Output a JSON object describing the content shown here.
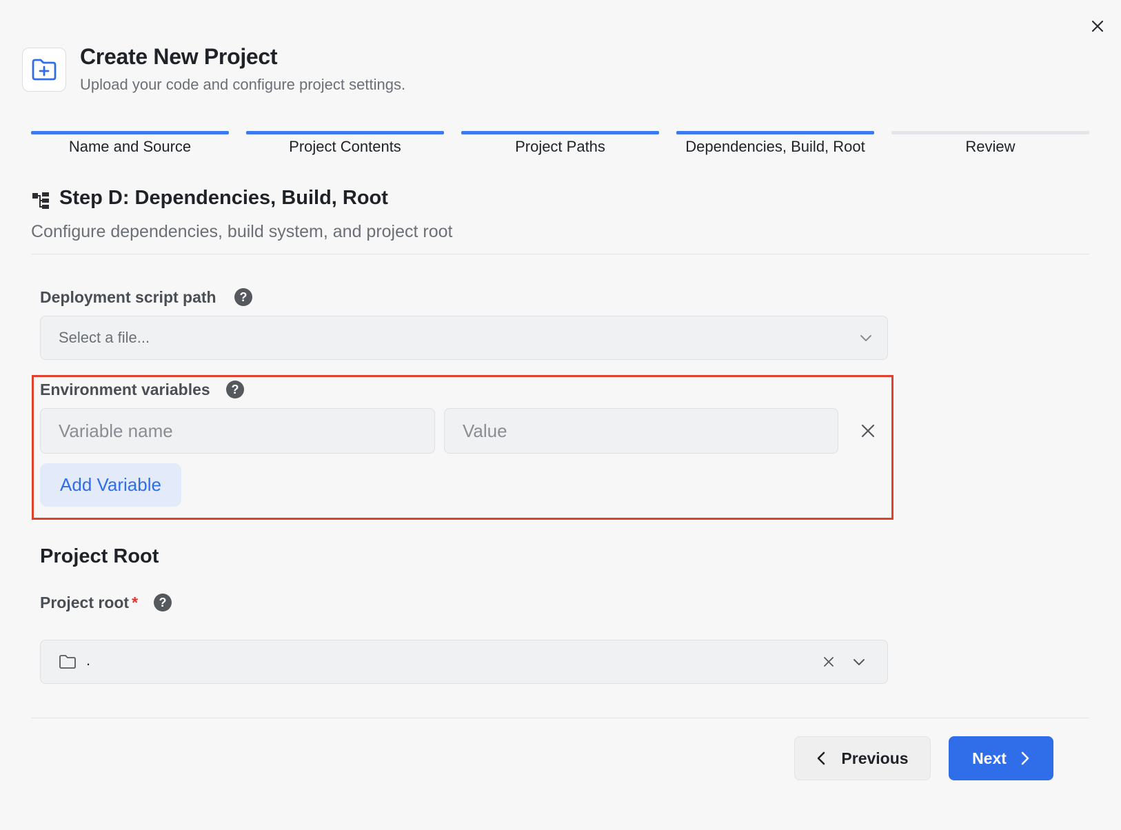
{
  "header": {
    "title": "Create New Project",
    "subtitle": "Upload your code and configure project settings.",
    "icon": "folder-plus-icon"
  },
  "steps": [
    {
      "label": "Name and Source",
      "complete": true
    },
    {
      "label": "Project Contents",
      "complete": true
    },
    {
      "label": "Project Paths",
      "complete": true
    },
    {
      "label": "Dependencies, Build, Root",
      "complete": true
    },
    {
      "label": "Review",
      "complete": false
    }
  ],
  "section": {
    "title": "Step D: Dependencies, Build, Root",
    "subtitle": "Configure dependencies, build system, and project root",
    "icon": "hierarchy-icon"
  },
  "deployment_script": {
    "label": "Deployment script path",
    "placeholder": "Select a file..."
  },
  "env_vars": {
    "label": "Environment variables",
    "name_placeholder": "Variable name",
    "value_placeholder": "Value",
    "add_label": "Add Variable"
  },
  "project_root": {
    "heading": "Project Root",
    "label": "Project root",
    "required_mark": "*",
    "value": "."
  },
  "help_glyph": "?",
  "footer": {
    "previous_label": "Previous",
    "next_label": "Next"
  },
  "colors": {
    "accent": "#2f6ee8",
    "step_active": "#3d7af0",
    "step_inactive": "#e4e5e8",
    "highlight_border": "#e0412f",
    "required": "#e0352b"
  }
}
